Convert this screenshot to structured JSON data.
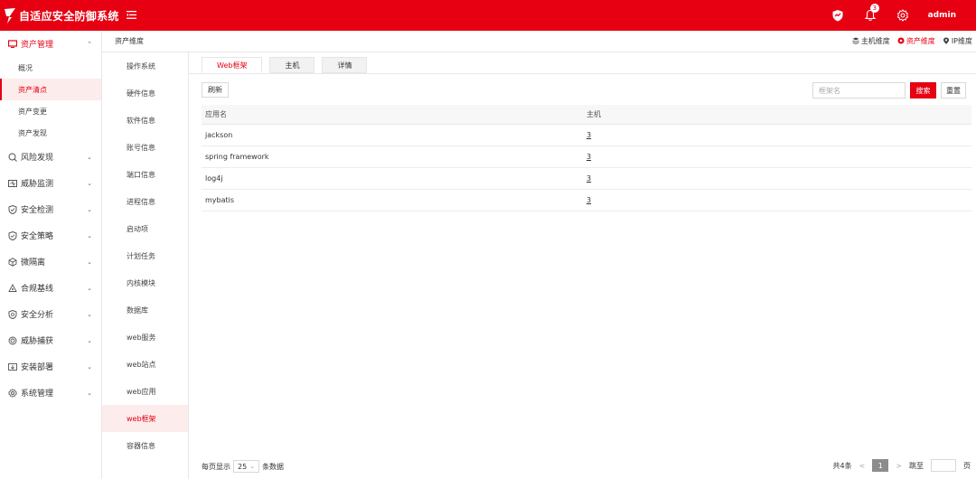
{
  "header": {
    "title": "自适应安全防御系统",
    "notification_count": "3",
    "user": "admin",
    "bg_color": "#e60012"
  },
  "sidebar": {
    "groups": [
      {
        "label": "资产管理",
        "icon": "monitor-icon",
        "active": true
      },
      {
        "label": "风险发现",
        "icon": "search-risk-icon"
      },
      {
        "label": "威胁监测",
        "icon": "monitor-threat-icon"
      },
      {
        "label": "安全检测",
        "icon": "shield-check-icon"
      },
      {
        "label": "安全策略",
        "icon": "shield-policy-icon"
      },
      {
        "label": "微隔离",
        "icon": "cube-icon"
      },
      {
        "label": "合规基线",
        "icon": "baseline-icon"
      },
      {
        "label": "安全分析",
        "icon": "shield-analysis-icon"
      },
      {
        "label": "威胁捕获",
        "icon": "target-icon"
      },
      {
        "label": "安装部署",
        "icon": "download-box-icon"
      },
      {
        "label": "系统管理",
        "icon": "gear-icon"
      }
    ],
    "sub_items": [
      "概况",
      "资产清点",
      "资产变更",
      "资产发现"
    ],
    "active_sub": "资产清点"
  },
  "breadcrumb": {
    "title": "资产维度",
    "dimensions": [
      "主机维度",
      "资产维度",
      "IP维度"
    ],
    "active_dimension": "资产维度"
  },
  "subnav": {
    "items": [
      "操作系统",
      "硬件信息",
      "软件信息",
      "账号信息",
      "端口信息",
      "进程信息",
      "启动项",
      "计划任务",
      "内核模块",
      "数据库",
      "web服务",
      "web站点",
      "web应用",
      "web框架",
      "容器信息"
    ],
    "active": "web框架"
  },
  "tabs": [
    "Web框架",
    "主机",
    "详情"
  ],
  "toolbar": {
    "refresh_label": "刷新",
    "search_placeholder": "框架名",
    "search_label": "搜索",
    "reset_label": "重置"
  },
  "table": {
    "headers": [
      "应用名",
      "主机"
    ],
    "rows": [
      {
        "name": "jackson",
        "hosts": "3"
      },
      {
        "name": "spring framework",
        "hosts": "3"
      },
      {
        "name": "log4j",
        "hosts": "3"
      },
      {
        "name": "mybatis",
        "hosts": "3"
      }
    ]
  },
  "pagination": {
    "per_page_label": "每页显示",
    "per_page_value": "25",
    "per_page_suffix": "条数据",
    "total_label": "共4条",
    "prev": "<",
    "current_page": "1",
    "next": ">",
    "jump_label": "跳至",
    "page_suffix": "页"
  }
}
